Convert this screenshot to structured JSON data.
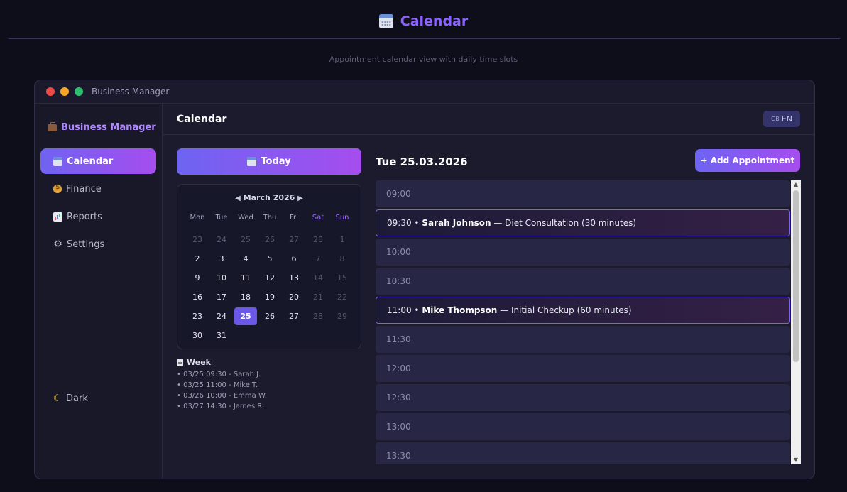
{
  "page": {
    "title": "Calendar",
    "subtitle": "Appointment calendar view with daily time slots"
  },
  "window": {
    "title": "Business Manager"
  },
  "sidebar": {
    "brand": "Business Manager",
    "items": [
      {
        "label": "Calendar",
        "icon": "calendar-icon",
        "active": true
      },
      {
        "label": "Finance",
        "icon": "money-bag-icon",
        "active": false
      },
      {
        "label": "Reports",
        "icon": "bar-chart-icon",
        "active": false
      },
      {
        "label": "Settings",
        "icon": "gear-icon",
        "active": false
      }
    ],
    "theme_label": "Dark"
  },
  "main": {
    "title": "Calendar",
    "lang_flag": "GB",
    "lang_label": "EN",
    "today_label": "Today",
    "add_label": "Add Appointment",
    "add_plus": "+",
    "day_title": "Tue 25.03.2026"
  },
  "mini_calendar": {
    "month_label": "March 2026",
    "prev_arrow": "◀",
    "next_arrow": "▶",
    "weekdays": [
      "Mon",
      "Tue",
      "Wed",
      "Thu",
      "Fri",
      "Sat",
      "Sun"
    ],
    "weeks": [
      [
        "23",
        "24",
        "25",
        "26",
        "27",
        "28",
        "1"
      ],
      [
        "2",
        "3",
        "4",
        "5",
        "6",
        "7",
        "8"
      ],
      [
        "9",
        "10",
        "11",
        "12",
        "13",
        "14",
        "15"
      ],
      [
        "16",
        "17",
        "18",
        "19",
        "20",
        "21",
        "22"
      ],
      [
        "23",
        "24",
        "25",
        "26",
        "27",
        "28",
        "29"
      ],
      [
        "30",
        "31",
        "",
        "",
        "",
        "",
        ""
      ]
    ],
    "selected": "25"
  },
  "week": {
    "title": "Week",
    "items": [
      "• 03/25 09:30 - Sarah J.",
      "• 03/25 11:00 - Mike T.",
      "• 03/26 10:00 - Emma W.",
      "• 03/27 14:30 - James R."
    ]
  },
  "slots": [
    {
      "time": "09:00"
    },
    {
      "time": "09:30",
      "name": "Sarah Johnson",
      "detail": "— Diet Consultation (30 minutes)"
    },
    {
      "time": "10:00"
    },
    {
      "time": "10:30"
    },
    {
      "time": "11:00",
      "name": "Mike Thompson",
      "detail": "— Initial Checkup (60 minutes)"
    },
    {
      "time": "11:30"
    },
    {
      "time": "12:00"
    },
    {
      "time": "12:30"
    },
    {
      "time": "13:00"
    },
    {
      "time": "13:30"
    }
  ],
  "colors": {
    "accent": "#8a63ff",
    "gradient_start": "#6d64f2",
    "gradient_end": "#a64dee",
    "background": "#0e0e1b",
    "panel": "#1b1b2d"
  }
}
